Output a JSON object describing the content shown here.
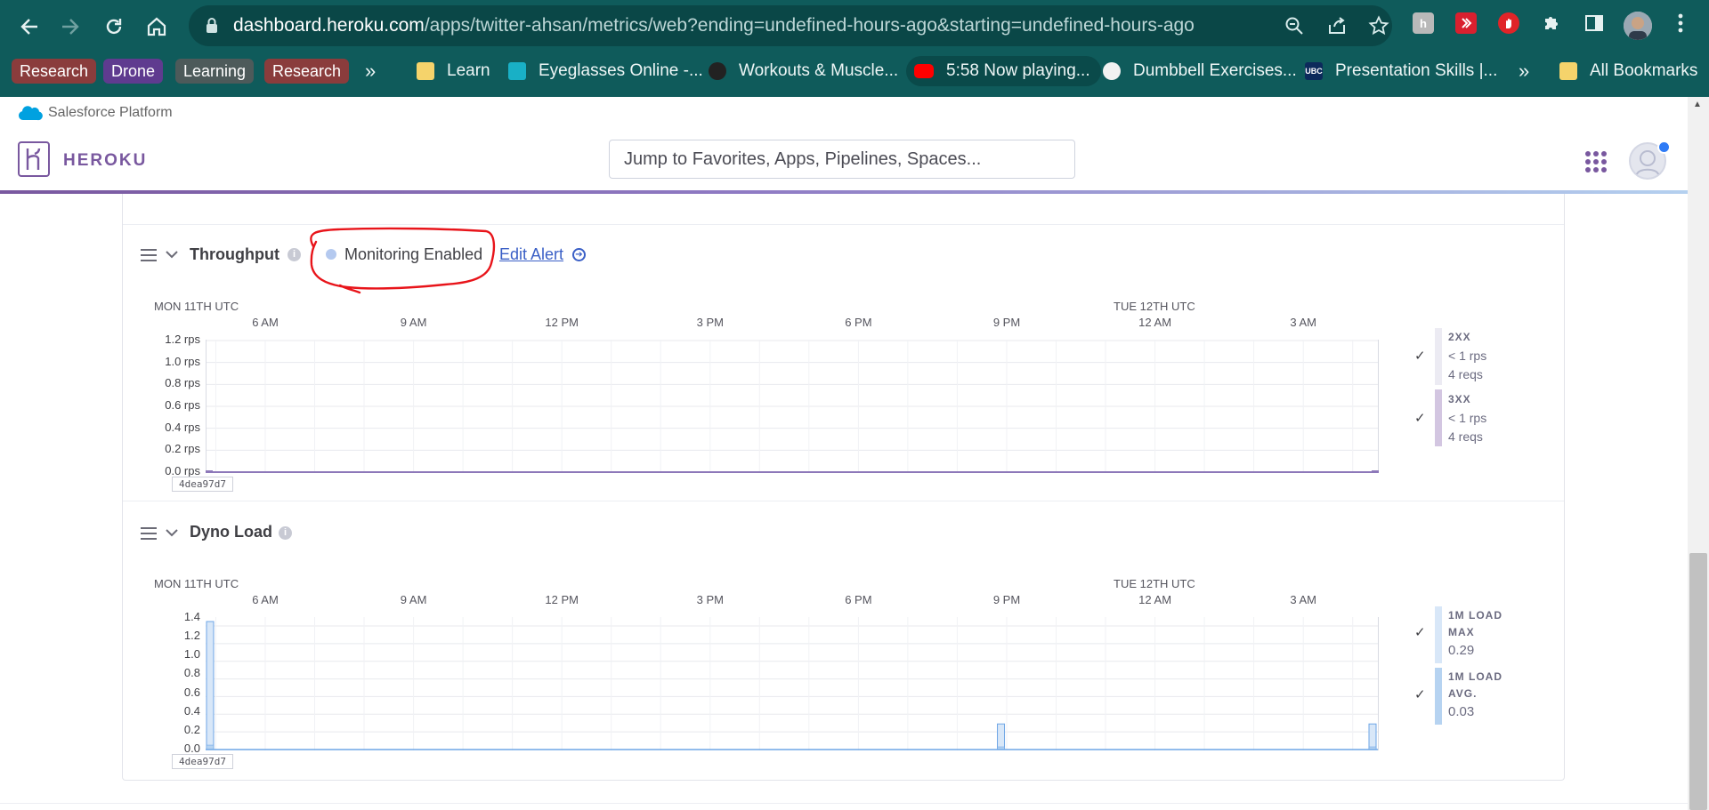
{
  "browser": {
    "url_host": "dashboard.heroku.com",
    "url_path": "/apps/twitter-ahsan/metrics/web?ending=undefined-hours-ago&starting=undefined-hours-ago",
    "bookmark_groups": [
      {
        "label": "Research",
        "color": "#8a3c3c"
      },
      {
        "label": "Drone",
        "color": "#5f3b8f"
      },
      {
        "label": "Learning",
        "color": "#4d5a5a"
      },
      {
        "label": "Research",
        "color": "#8a3c3c"
      }
    ],
    "bookmarks": [
      {
        "label": "Learn",
        "icon": "folder-icon"
      },
      {
        "label": "Eyeglasses Online -...",
        "icon": "zenni-icon"
      },
      {
        "label": "Workouts & Muscle...",
        "icon": "dumbbell-icon"
      },
      {
        "label": "5:58 Now playing...",
        "icon": "youtube-icon"
      },
      {
        "label": "Dumbbell Exercises...",
        "icon": "globe-icon"
      },
      {
        "label": "Presentation Skills |...",
        "icon": "ubc-icon"
      }
    ],
    "all_bookmarks_label": "All Bookmarks",
    "ubc_icon_text": "UBC"
  },
  "salesforce": {
    "label": "Salesforce Platform"
  },
  "heroku": {
    "logo_text": "HEROKU",
    "search_placeholder": "Jump to Favorites, Apps, Pipelines, Spaces..."
  },
  "throughput": {
    "title": "Throughput",
    "monitoring_label": "Monitoring Enabled",
    "edit_alert_label": "Edit Alert",
    "release_tag": "4dea97d7",
    "legend": [
      {
        "name": "2XX",
        "rate": "< 1 rps",
        "count": "4 reqs",
        "color": "#ecebf3"
      },
      {
        "name": "3XX",
        "rate": "< 1 rps",
        "count": "4 reqs",
        "color": "#d3c6e1"
      }
    ]
  },
  "dyno_load": {
    "title": "Dyno Load",
    "release_tag": "4dea97d7",
    "legend": [
      {
        "name_line1": "1M LOAD",
        "name_line2": "MAX",
        "value": "0.29",
        "color": "#d8e7f8"
      },
      {
        "name_line1": "1M LOAD",
        "name_line2": "AVG.",
        "value": "0.03",
        "color": "#b6d3f1"
      }
    ]
  },
  "time_axis": {
    "day_labels": [
      "MON 11TH UTC",
      "TUE 12TH UTC"
    ],
    "ticks": [
      "6 AM",
      "9 AM",
      "12 PM",
      "3 PM",
      "6 PM",
      "9 PM",
      "12 AM",
      "3 AM"
    ]
  },
  "chart_data": [
    {
      "type": "line",
      "title": "Throughput",
      "ylabel": "rps",
      "ylim": [
        0,
        1.2
      ],
      "y_ticks": [
        "1.2 rps",
        "1.0 rps",
        "0.8 rps",
        "0.6 rps",
        "0.4 rps",
        "0.2 rps",
        "0.0 rps"
      ],
      "x_ticks": [
        "6 AM",
        "9 AM",
        "12 PM",
        "3 PM",
        "6 PM",
        "9 PM",
        "12 AM",
        "3 AM"
      ],
      "series": [
        {
          "name": "2XX",
          "values": [
            0,
            0,
            0,
            0,
            0,
            0,
            0,
            0,
            0
          ],
          "color": "#ecebf3"
        },
        {
          "name": "3XX",
          "values": [
            0,
            0,
            0,
            0,
            0,
            0,
            0,
            0,
            0
          ],
          "color": "#9a86c2"
        }
      ]
    },
    {
      "type": "bar",
      "title": "Dyno Load",
      "ylim": [
        0,
        1.5
      ],
      "y_ticks": [
        "1.4",
        "1.2",
        "1.0",
        "0.8",
        "0.6",
        "0.4",
        "0.2",
        "0.0"
      ],
      "x_ticks": [
        "6 AM",
        "9 AM",
        "12 PM",
        "3 PM",
        "6 PM",
        "9 PM",
        "12 AM",
        "3 AM"
      ],
      "x_hours_from_mon_4_30am": [
        0,
        16,
        24
      ],
      "series": [
        {
          "name": "1M LOAD MAX",
          "values": [
            1.45,
            0.29,
            0.29
          ],
          "color": "#d8e7f8"
        },
        {
          "name": "1M LOAD AVG.",
          "values": [
            0.05,
            0.03,
            0.03
          ],
          "color": "#b6d3f1"
        }
      ]
    }
  ]
}
